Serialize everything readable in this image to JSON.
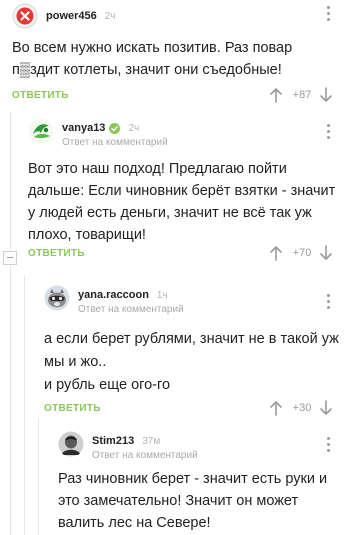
{
  "comments": [
    {
      "author": "power456",
      "time": "2ч",
      "reply_to": "",
      "text": "Во всем нужно искать позитив. Раз повар п▒здит котлеты, значит они съедобные!",
      "reply_label": "ОТВЕТИТЬ",
      "rating": "+87",
      "avatar_icon": "deleted-user-x-icon"
    },
    {
      "author": "vanya13",
      "time": "2ч",
      "reply_prefix": "Ответ на",
      "reply_target": "комментарий",
      "text": "Вот это наш подход! Предлагаю пойти дальше: Если чиновник берёт взятки - значит у людей есть деньги, значит не всё так уж плохо, товарищи!",
      "reply_label": "ОТВЕТИТЬ",
      "rating": "+70",
      "avatar_icon": "green-globe-avatar"
    },
    {
      "author": "yana.raccoon",
      "time": "1ч",
      "reply_prefix": "Ответ на",
      "reply_target": "комментарий",
      "text": "а если берет рублями, значит не в такой уж мы и жо..\nи рубль еще ого-го",
      "reply_label": "ОТВЕТИТЬ",
      "rating": "+30",
      "avatar_icon": "raccoon-avatar"
    },
    {
      "author": "Stim213",
      "time": "37м",
      "reply_prefix": "Ответ на",
      "reply_target": "комментарий",
      "text": "Раз чиновник берет - значит есть руки и это замечательно! Значит он может валить лес на Севере!",
      "avatar_icon": "bw-photo-avatar"
    }
  ],
  "colors": {
    "accent_green": "#8ac858",
    "muted_gray": "#9a9a9a",
    "deleted_red": "#e53935",
    "verified_green": "#8ac858"
  }
}
